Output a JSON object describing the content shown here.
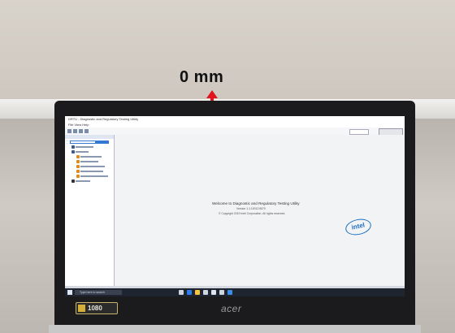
{
  "annotation": {
    "gap_label": "0 mm",
    "arrow_color": "#e0141c"
  },
  "app": {
    "window_title": "DRTU - Diagnostic and Regulatory Testing Utility",
    "menu": "File  View  Help",
    "welcome_title": "Welcome to Diagnostic and Regulatory Testing Utility",
    "version": "Version 1.1.10012.6570",
    "copyright": "© Copyright 2019 Intel Corporation. All rights reserved.",
    "vendor_logo_text": "intel"
  },
  "taskbar": {
    "search_placeholder": "Type here to search"
  },
  "device": {
    "badge_text": "1080",
    "brand": "acer"
  },
  "colors": {
    "bezel": "#1b1b1d",
    "screen_bg": "#e9ecef",
    "intel_blue": "#1f6fc5",
    "arrow": "#e0141c"
  }
}
